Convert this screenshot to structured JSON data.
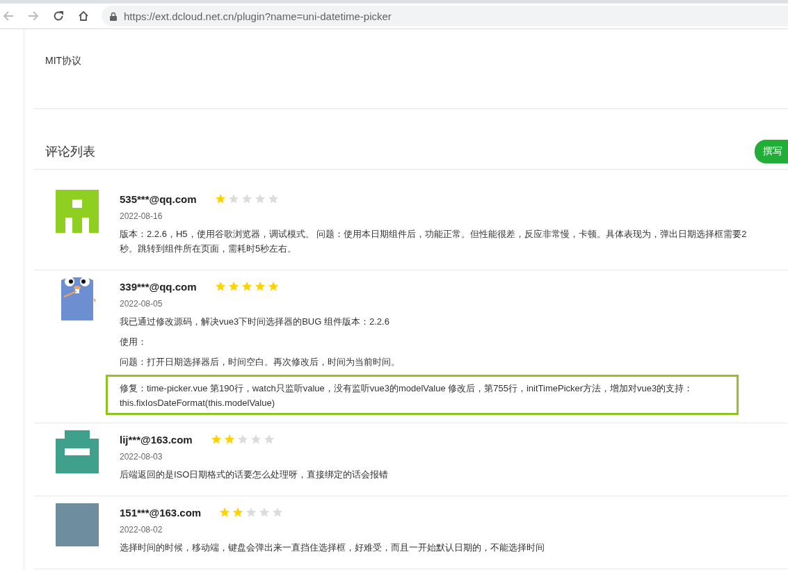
{
  "browser": {
    "url": "https://ext.dcloud.net.cn/plugin?name=uni-datetime-picker"
  },
  "license": {
    "text": "MIT协议"
  },
  "comments": {
    "title": "评论列表",
    "write_button": "撰写",
    "items": [
      {
        "user": "535***@qq.com",
        "stars": 1,
        "date": "2022-08-16",
        "avatar": {
          "kind": "identicon-a",
          "color": "#8fcf22"
        },
        "paragraphs": [
          {
            "text": "版本：2.2.6，H5，使用谷歌浏览器，调试模式。 问题：使用本日期组件后，功能正常。但性能很差，反应非常慢，卡顿。具体表现为，弹出日期选择框需要2秒。跳转到组件所在页面，需耗时5秒左右。",
            "highlighted": false
          }
        ]
      },
      {
        "user": "339***@qq.com",
        "stars": 5,
        "date": "2022-08-05",
        "avatar": {
          "kind": "gopher",
          "color": "#6b8fd0"
        },
        "paragraphs": [
          {
            "text": "我已通过修改源码，解决vue3下时间选择器的BUG 组件版本：2.2.6",
            "highlighted": false
          },
          {
            "text": "使用：",
            "highlighted": false
          },
          {
            "text": "问题：打开日期选择器后，时间空白。再次修改后，时间为当前时间。",
            "highlighted": false
          },
          {
            "text": "修复：time-picker.vue 第190行，watch只监听value，没有监听vue3的modelValue 修改后，第755行，initTimePicker方法，增加对vue3的支持：this.fixIosDateFormat(this.modelValue)",
            "highlighted": true
          }
        ]
      },
      {
        "user": "lij***@163.com",
        "stars": 2,
        "date": "2022-08-03",
        "avatar": {
          "kind": "identicon-b",
          "color": "#3fa18b"
        },
        "paragraphs": [
          {
            "text": "后端返回的是ISO日期格式的话要怎么处理呀，直接绑定的话会报错",
            "highlighted": false
          }
        ]
      },
      {
        "user": "151***@163.com",
        "stars": 2,
        "date": "2022-08-02",
        "avatar": {
          "kind": "plain",
          "color": "#6e8e9e"
        },
        "paragraphs": [
          {
            "text": "选择时间的时候，移动端，键盘会弹出来一直挡住选择框，好难受，而且一开始默认日期的，不能选择时间",
            "highlighted": false
          }
        ]
      }
    ]
  }
}
